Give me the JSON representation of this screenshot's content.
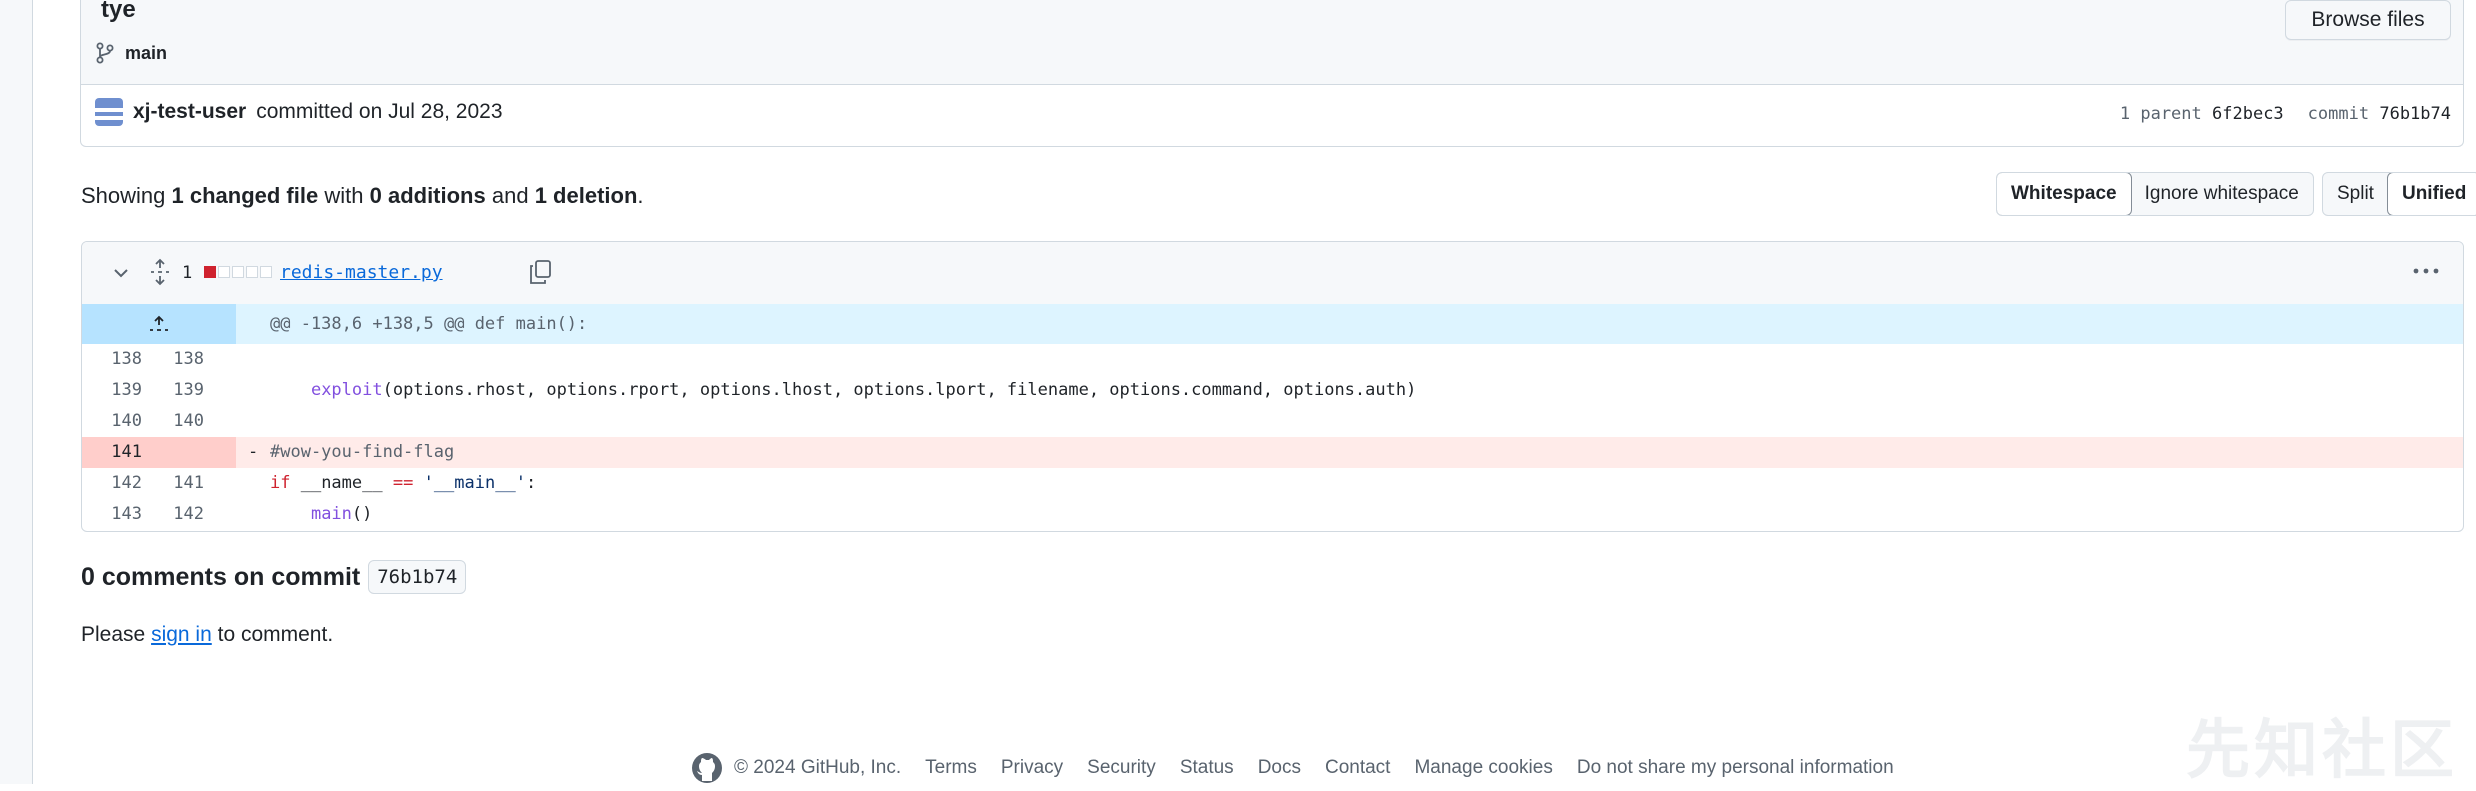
{
  "commit": {
    "title": "tye",
    "branch": "main",
    "browse_files_label": "Browse files",
    "author": "xj-test-user",
    "committed_text": "committed on Jul 28, 2023",
    "parent_label": "1 parent",
    "parent_sha": "6f2bec3",
    "commit_label": "commit",
    "commit_sha": "76b1b74"
  },
  "summary": {
    "showing": "Showing",
    "files": "1 changed file",
    "with": "with",
    "additions": "0 additions",
    "and": "and",
    "deletions": "1 deletion",
    "period": "."
  },
  "whitespace_toggle": {
    "options": [
      "Whitespace",
      "Ignore whitespace"
    ],
    "selected": "Whitespace"
  },
  "view_toggle": {
    "options": [
      "Split",
      "Unified"
    ],
    "selected": "Unified"
  },
  "file": {
    "change_count": "1",
    "diffstat": [
      "deletion",
      "neutral",
      "neutral",
      "neutral",
      "neutral"
    ],
    "filename": "redis-master.py",
    "hunk_header": "@@ -138,6 +138,5 @@ def main():",
    "lines": [
      {
        "old": "138",
        "new": "138",
        "type": "context",
        "sign": "",
        "code": ""
      },
      {
        "old": "139",
        "new": "139",
        "type": "context",
        "sign": "",
        "code": "    exploit(options.rhost, options.rport, options.lhost, options.lport, filename, options.command, options.auth)"
      },
      {
        "old": "140",
        "new": "140",
        "type": "context",
        "sign": "",
        "code": ""
      },
      {
        "old": "141",
        "new": "",
        "type": "deletion",
        "sign": "-",
        "code": "#wow-you-find-flag"
      },
      {
        "old": "142",
        "new": "141",
        "type": "context",
        "sign": "",
        "code": "if __name__ == '__main__':"
      },
      {
        "old": "143",
        "new": "142",
        "type": "context",
        "sign": "",
        "code": "    main()"
      }
    ]
  },
  "comments": {
    "title": "0 comments on commit",
    "sha": "76b1b74",
    "please": "Please",
    "sign_in": "sign in",
    "to_comment": "to comment."
  },
  "footer": {
    "copyright": "© 2024 GitHub, Inc.",
    "links": [
      "Terms",
      "Privacy",
      "Security",
      "Status",
      "Docs",
      "Contact",
      "Manage cookies",
      "Do not share my personal information"
    ]
  },
  "watermark": "先知社区",
  "colors": {
    "link": "#0969da",
    "deletion": "#cf222e",
    "deletion_bg": "#ffebe9",
    "hunk_bg": "#ddf4ff"
  }
}
